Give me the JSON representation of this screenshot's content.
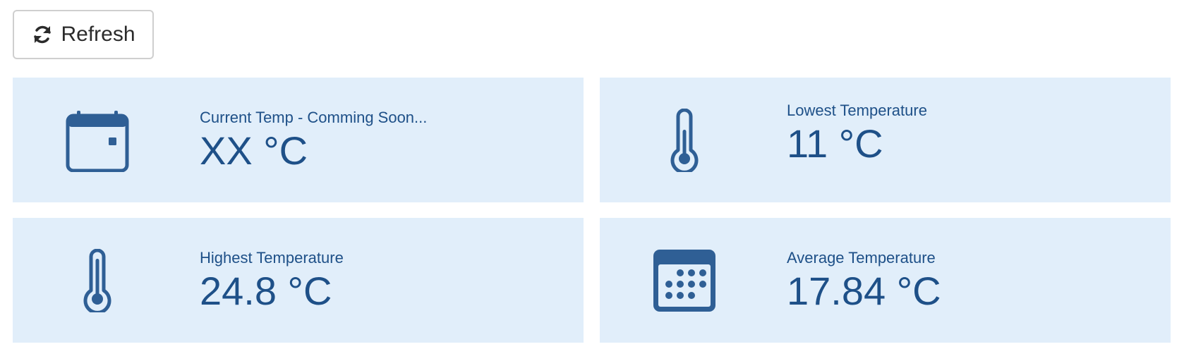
{
  "toolbar": {
    "refresh_label": "Refresh",
    "refresh_icon": "refresh-icon"
  },
  "cards": [
    {
      "id": "current",
      "icon": "calendar-icon",
      "label": "Current Temp - Comming Soon...",
      "value": "XX °C"
    },
    {
      "id": "lowest",
      "icon": "thermometer-icon",
      "label": "Lowest Temperature",
      "value": "11 °C"
    },
    {
      "id": "highest",
      "icon": "thermometer-icon",
      "label": "Highest Temperature",
      "value": "24.8 °C"
    },
    {
      "id": "average",
      "icon": "calendar-days-icon",
      "label": "Average Temperature",
      "value": "17.84 °C"
    }
  ],
  "colors": {
    "card_background": "#e1eefa",
    "text_accent": "#1e5088",
    "icon": "#2f5f95"
  }
}
